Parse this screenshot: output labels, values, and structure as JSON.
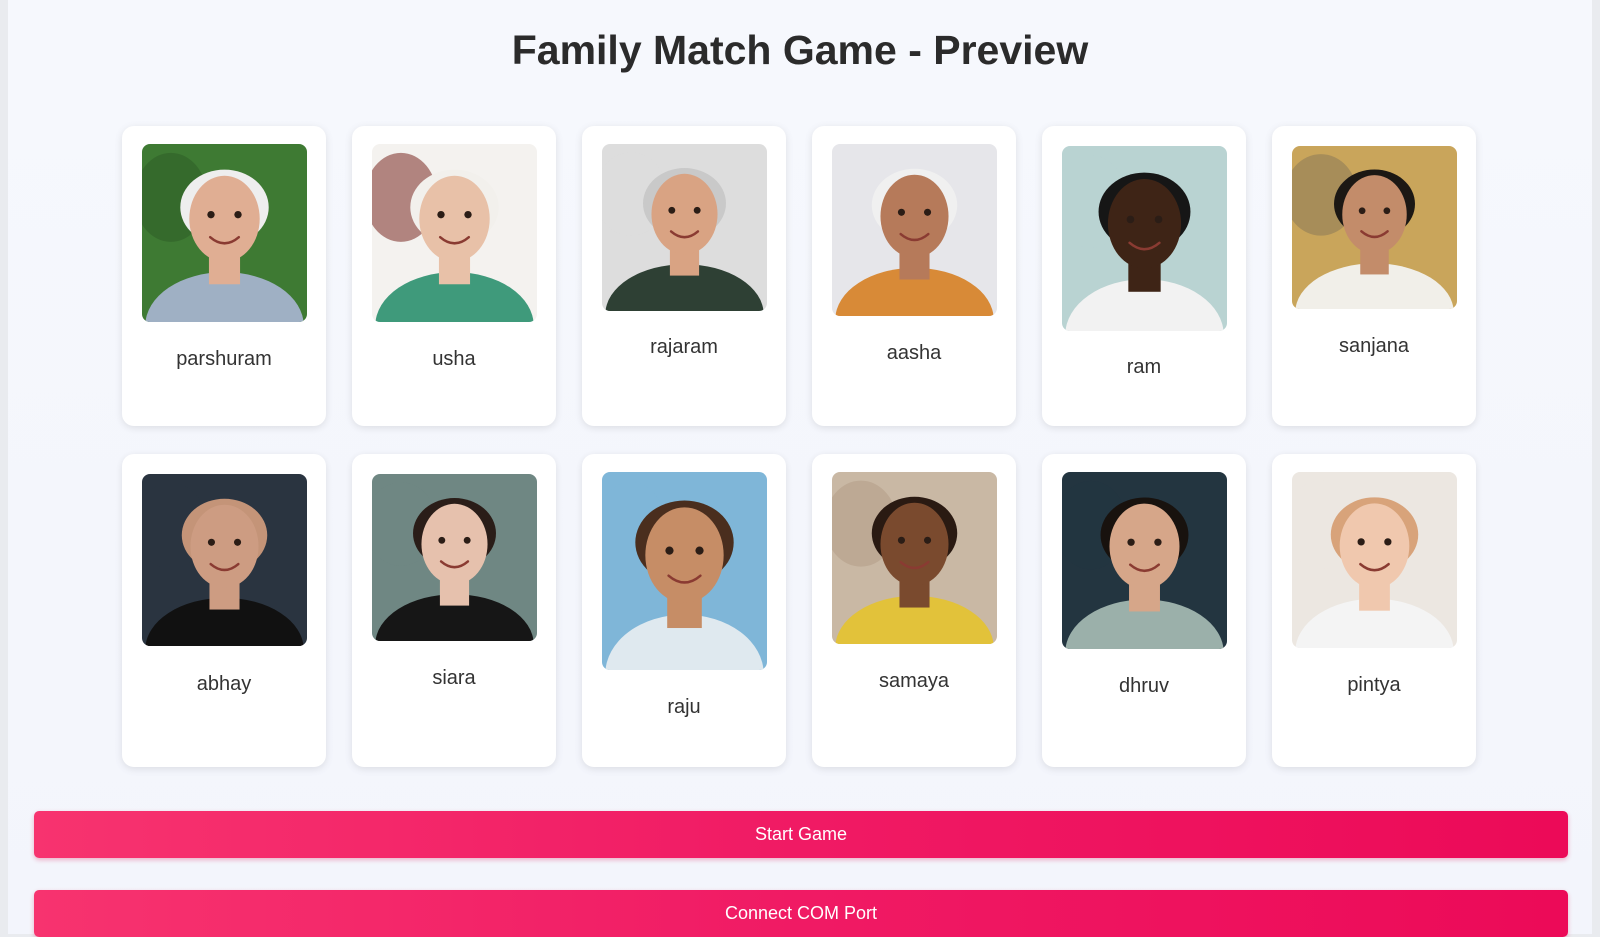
{
  "title": "Family Match Game - Preview",
  "cards": [
    {
      "name": "parshuram",
      "bg": "#3e7a33",
      "skin": "#e0ae93",
      "hair": "#eeeeee",
      "shirt": "#9fb0c4",
      "accent": "#2d5d26"
    },
    {
      "name": "usha",
      "bg": "#f4f2ef",
      "skin": "#e8c1a8",
      "hair": "#f2f0ec",
      "shirt": "#3f9a7b",
      "accent": "#7a2a22"
    },
    {
      "name": "rajaram",
      "bg": "#dddddd",
      "skin": "#d9a383",
      "hair": "#c9c9c9",
      "shirt": "#2e4034",
      "accent": "#dddddd"
    },
    {
      "name": "aasha",
      "bg": "#e6e6ea",
      "skin": "#b67a5a",
      "hair": "#f0f0f0",
      "shirt": "#d88a37",
      "accent": "#e6e6ea"
    },
    {
      "name": "ram",
      "bg": "#b9d3d2",
      "skin": "#3e2416",
      "hair": "#161616",
      "shirt": "#f2f2f2",
      "accent": "#b9d3d2"
    },
    {
      "name": "sanjana",
      "bg": "#c9a55b",
      "skin": "#c38c6a",
      "hair": "#1c1814",
      "shirt": "#f1efe9",
      "accent": "#8a7a58"
    },
    {
      "name": "abhay",
      "bg": "#2a3440",
      "skin": "#cd9c82",
      "hair": "#c49478",
      "shirt": "#111111",
      "accent": "#2a3440"
    },
    {
      "name": "siara",
      "bg": "#6f8783",
      "skin": "#e6c1ad",
      "hair": "#2a1d18",
      "shirt": "#161616",
      "accent": "#6f8783"
    },
    {
      "name": "raju",
      "bg": "#7fb6d8",
      "skin": "#c68d66",
      "hair": "#4a2e1e",
      "shirt": "#dfe9ef",
      "accent": "#7fb6d8"
    },
    {
      "name": "samaya",
      "bg": "#c9b8a4",
      "skin": "#7a4a2e",
      "hair": "#2a1a12",
      "shirt": "#e2c23a",
      "accent": "#b39d86"
    },
    {
      "name": "dhruv",
      "bg": "#233540",
      "skin": "#d6a689",
      "hair": "#18120e",
      "shirt": "#9bb0aa",
      "accent": "#233540"
    },
    {
      "name": "pintya",
      "bg": "#ece7e1",
      "skin": "#f0c8ae",
      "hair": "#d8a37a",
      "shirt": "#f4f4f4",
      "accent": "#ece7e1"
    }
  ],
  "buttons": {
    "start": "Start Game",
    "connect": "Connect COM Port"
  }
}
